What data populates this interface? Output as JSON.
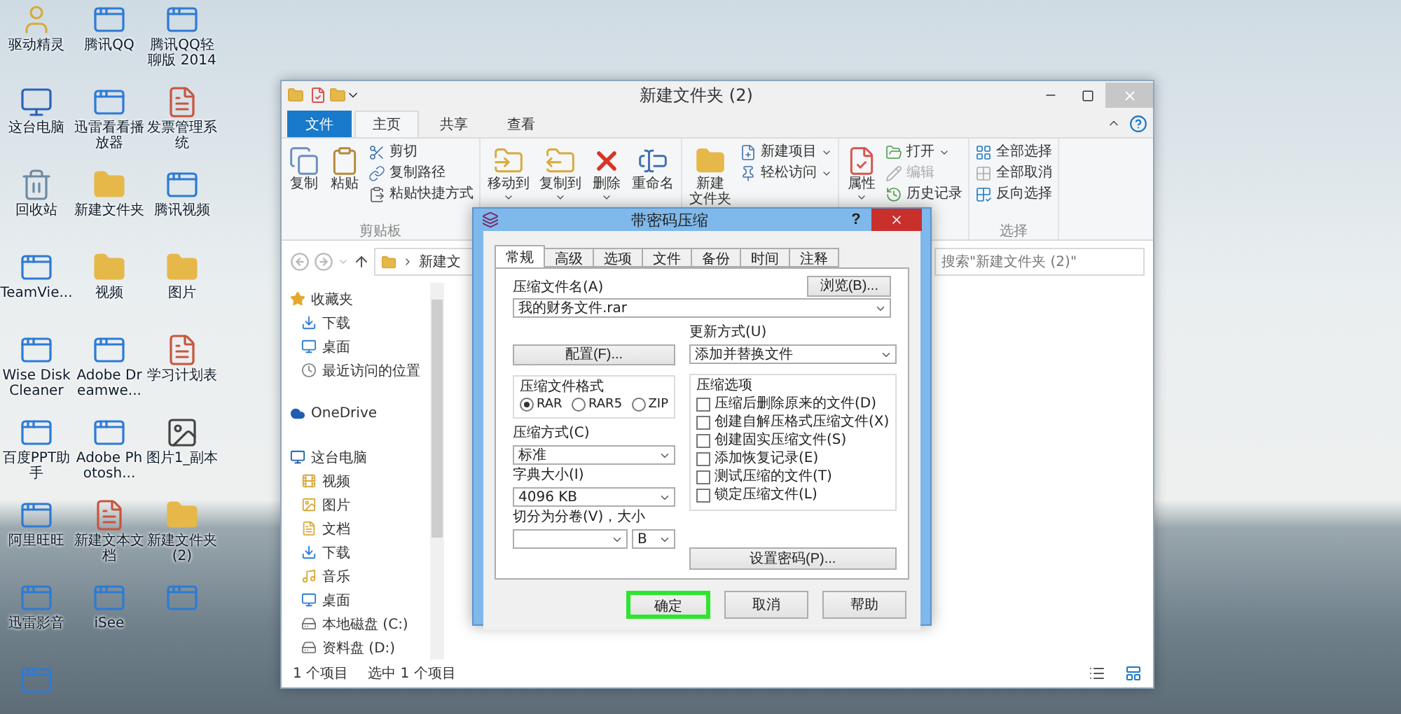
{
  "desktop": {
    "icons": [
      {
        "label": "驱动精灵",
        "kind": "user"
      },
      {
        "label": "腾讯QQ",
        "kind": "app"
      },
      {
        "label": "腾讯QQ轻聊版 2014",
        "kind": "app"
      },
      {
        "label": "这台电脑",
        "kind": "pc"
      },
      {
        "label": "迅雷看看播放器",
        "kind": "app"
      },
      {
        "label": "发票管理系统",
        "kind": "file"
      },
      {
        "label": "回收站",
        "kind": "bin"
      },
      {
        "label": "新建文件夹",
        "kind": "folder"
      },
      {
        "label": "腾讯视频",
        "kind": "app"
      },
      {
        "label": "TeamVie...",
        "kind": "app"
      },
      {
        "label": "视频",
        "kind": "folder"
      },
      {
        "label": "图片",
        "kind": "folder"
      },
      {
        "label": "Wise Disk Cleaner",
        "kind": "app"
      },
      {
        "label": "Adobe Dreamwe...",
        "kind": "app"
      },
      {
        "label": "学习计划表",
        "kind": "file"
      },
      {
        "label": "百度PPT助手",
        "kind": "app"
      },
      {
        "label": "Adobe Photosh...",
        "kind": "app"
      },
      {
        "label": "图片1_副本",
        "kind": "photo"
      },
      {
        "label": "阿里旺旺",
        "kind": "app"
      },
      {
        "label": "新建文本文档",
        "kind": "file"
      },
      {
        "label": "新建文件夹 (2)",
        "kind": "folder"
      },
      {
        "label": "迅雷影音",
        "kind": "app"
      },
      {
        "label": "iSee",
        "kind": "app"
      },
      {
        "kind": "app"
      },
      {
        "kind": "app"
      }
    ]
  },
  "explorer": {
    "title": "新建文件夹 (2)",
    "ribbon_tabs": [
      {
        "label": "文件",
        "kind": "file",
        "selected": false
      },
      {
        "label": "主页",
        "kind": "tab",
        "selected": true
      },
      {
        "label": "共享",
        "kind": "tab",
        "selected": false
      },
      {
        "label": "查看",
        "kind": "tab",
        "selected": false
      }
    ],
    "ribbon_groups": [
      {
        "label": "剪贴板",
        "large": [
          {
            "label": "复制",
            "kind": "copy",
            "dropdown": false
          },
          {
            "label": "粘贴",
            "kind": "paste",
            "dropdown": false
          }
        ],
        "small": [
          {
            "label": "剪切",
            "kind": "cut",
            "dropdown": false,
            "disabled": false
          },
          {
            "label": "复制路径",
            "kind": "path",
            "dropdown": false,
            "disabled": false
          },
          {
            "label": "粘贴快捷方式",
            "kind": "shortcut",
            "dropdown": false,
            "disabled": false
          }
        ]
      },
      {
        "large": [
          {
            "label": "移动到",
            "kind": "move",
            "dropdown": true
          },
          {
            "label": "复制到",
            "kind": "copyto",
            "dropdown": true
          },
          {
            "label": "删除",
            "kind": "delete",
            "dropdown": true
          },
          {
            "label": "重命名",
            "kind": "rename",
            "dropdown": false
          }
        ]
      },
      {
        "large": [
          {
            "lines": [
              "新建",
              "文件夹"
            ],
            "kind": "newfolder",
            "dropdown": false
          }
        ],
        "small": [
          {
            "label": "新建项目",
            "kind": "newitem",
            "dropdown": true,
            "disabled": false
          },
          {
            "label": "轻松访问",
            "kind": "easy",
            "dropdown": true,
            "disabled": false
          }
        ]
      },
      {
        "large": [
          {
            "label": "属性",
            "kind": "props",
            "dropdown": true
          }
        ],
        "small": [
          {
            "label": "打开",
            "kind": "open",
            "dropdown": true,
            "disabled": false
          },
          {
            "label": "编辑",
            "kind": "edit",
            "dropdown": false,
            "disabled": true
          },
          {
            "label": "历史记录",
            "kind": "history",
            "dropdown": false,
            "disabled": false
          }
        ]
      },
      {
        "label": "选择",
        "small": [
          {
            "label": "全部选择",
            "kind": "selall",
            "dropdown": false,
            "disabled": false
          },
          {
            "label": "全部取消",
            "kind": "selnone",
            "dropdown": false,
            "disabled": false
          },
          {
            "label": "反向选择",
            "kind": "invert",
            "dropdown": false,
            "disabled": false
          }
        ]
      }
    ],
    "address": {
      "crumb": "新建文"
    },
    "search": {
      "placeholder": "搜索\"新建文件夹 (2)\""
    },
    "nav": [
      {
        "label": "收藏夹",
        "kind": "star",
        "children": [
          {
            "label": "下载",
            "kind": "download"
          },
          {
            "label": "桌面",
            "kind": "desktop"
          },
          {
            "label": "最近访问的位置",
            "kind": "recent"
          }
        ]
      },
      {
        "label": "OneDrive",
        "kind": "cloud"
      },
      {
        "label": "这台电脑",
        "kind": "pc",
        "children": [
          {
            "label": "视频",
            "kind": "video"
          },
          {
            "label": "图片",
            "kind": "picture"
          },
          {
            "label": "文档",
            "kind": "document"
          },
          {
            "label": "下载",
            "kind": "download"
          },
          {
            "label": "音乐",
            "kind": "music"
          },
          {
            "label": "桌面",
            "kind": "desktop"
          },
          {
            "label": "本地磁盘 (C:)",
            "kind": "drive"
          },
          {
            "label": "资料盘 (D:)",
            "kind": "drive"
          }
        ]
      }
    ],
    "status": [
      "1 个项目",
      "选中 1 个项目"
    ]
  },
  "dialog": {
    "title": "带密码压缩",
    "help": "?",
    "tabs": [
      {
        "label": "常规",
        "selected": true
      },
      {
        "label": "高级",
        "selected": false
      },
      {
        "label": "选项",
        "selected": false
      },
      {
        "label": "文件",
        "selected": false
      },
      {
        "label": "备份",
        "selected": false
      },
      {
        "label": "时间",
        "selected": false
      },
      {
        "label": "注释",
        "selected": false
      }
    ],
    "archive_name": {
      "label": "压缩文件名(A)",
      "value": "我的财务文件.rar",
      "browse": "浏览(B)..."
    },
    "profiles": "配置(F)...",
    "update_mode": {
      "label": "更新方式(U)",
      "value": "添加并替换文件"
    },
    "format": {
      "label": "压缩文件格式",
      "choices": [
        {
          "label": "RAR",
          "selected": true
        },
        {
          "label": "RAR5",
          "selected": false
        },
        {
          "label": "ZIP",
          "selected": false
        }
      ]
    },
    "options": {
      "label": "压缩选项",
      "items": [
        {
          "label": "压缩后删除原来的文件(D)",
          "checked": false
        },
        {
          "label": "创建自解压格式压缩文件(X)",
          "checked": false
        },
        {
          "label": "创建固实压缩文件(S)",
          "checked": false
        },
        {
          "label": "添加恢复记录(E)",
          "checked": false
        },
        {
          "label": "测试压缩的文件(T)",
          "checked": false
        },
        {
          "label": "锁定压缩文件(L)",
          "checked": false
        }
      ]
    },
    "method": {
      "label": "压缩方式(C)",
      "value": "标准"
    },
    "dictionary": {
      "label": "字典大小(I)",
      "value": "4096 KB"
    },
    "split": {
      "label": "切分为分卷(V)，大小",
      "unit": "B"
    },
    "password": "设置密码(P)...",
    "buttons": [
      {
        "label": "确定",
        "highlighted": true
      },
      {
        "label": "取消",
        "highlighted": false
      },
      {
        "label": "帮助",
        "highlighted": false
      }
    ]
  }
}
